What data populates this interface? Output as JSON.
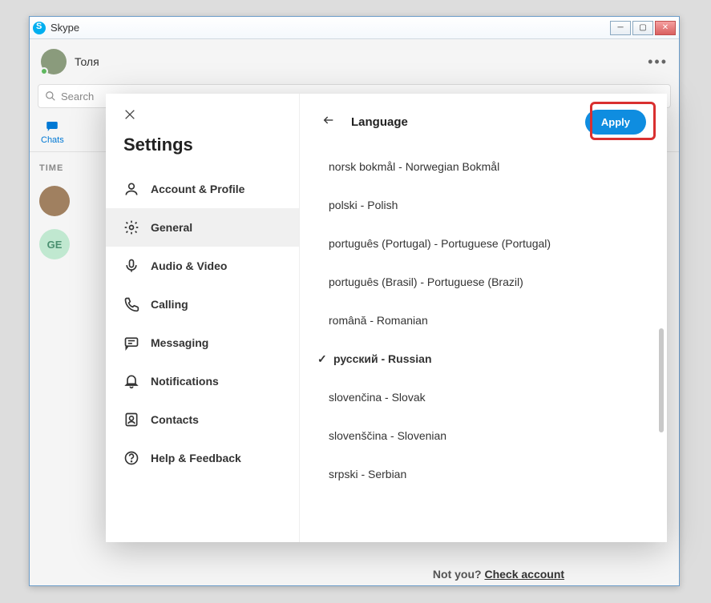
{
  "window": {
    "title": "Skype"
  },
  "user": {
    "name": "Толя"
  },
  "search": {
    "placeholder": "Search"
  },
  "tabs": {
    "chats": "Chats"
  },
  "sidebar": {
    "time_label": "TIME",
    "ge_initials": "GE"
  },
  "settings": {
    "title": "Settings",
    "items": [
      {
        "label": "Account & Profile"
      },
      {
        "label": "General"
      },
      {
        "label": "Audio & Video"
      },
      {
        "label": "Calling"
      },
      {
        "label": "Messaging"
      },
      {
        "label": "Notifications"
      },
      {
        "label": "Contacts"
      },
      {
        "label": "Help & Feedback"
      }
    ]
  },
  "language_panel": {
    "title": "Language",
    "apply_label": "Apply",
    "languages": [
      {
        "label": "norsk bokmål - Norwegian Bokmål"
      },
      {
        "label": "polski - Polish"
      },
      {
        "label": "português (Portugal) - Portuguese (Portugal)"
      },
      {
        "label": "português (Brasil) - Portuguese (Brazil)"
      },
      {
        "label": "română - Romanian"
      },
      {
        "label": "русский - Russian",
        "selected": true
      },
      {
        "label": "slovenčina - Slovak"
      },
      {
        "label": "slovenščina - Slovenian"
      },
      {
        "label": "srpski - Serbian"
      }
    ]
  },
  "footer": {
    "not_you": "Not you?",
    "check_account": "Check account"
  }
}
